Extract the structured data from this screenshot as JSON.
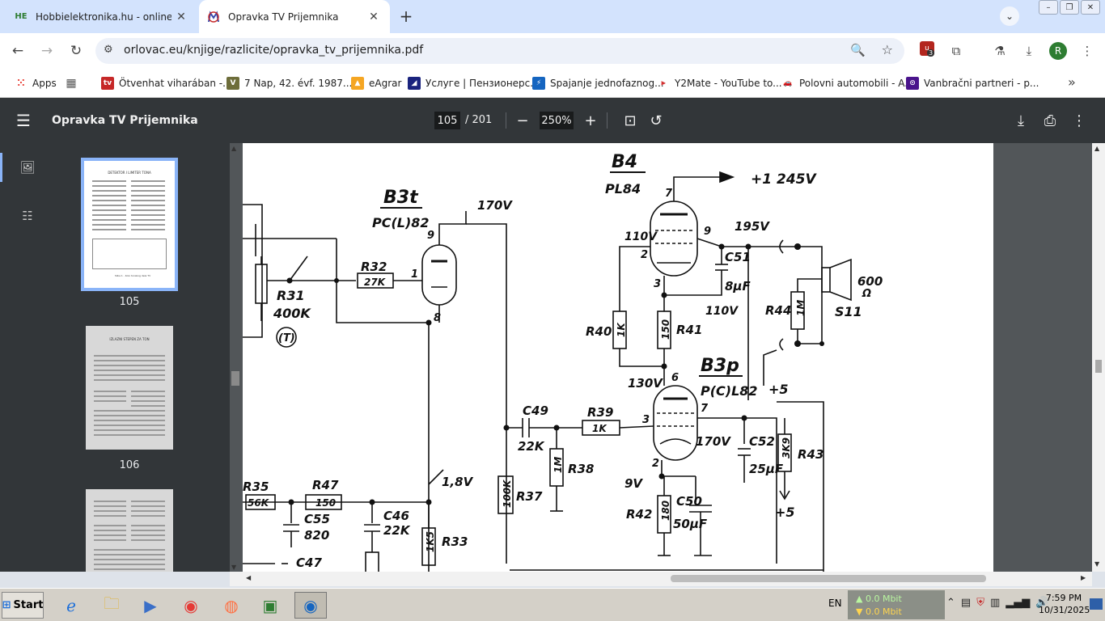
{
  "tabs": [
    {
      "title": "Hobbielektronika.hu - online elektronikai",
      "favicon": "HE"
    },
    {
      "title": "Opravka TV Prijemnika",
      "favicon": "PDF"
    }
  ],
  "address": {
    "url": "orlovac.eu/knjige/razlicite/opravka_tv_prijemnika.pdf",
    "profile_initial": "R",
    "ext_badge_count": "3"
  },
  "bookmarks": [
    {
      "label": "Apps",
      "icon_color": "#e8453c"
    },
    {
      "label": "",
      "icon_color": "#555555"
    },
    {
      "label": "Ötvenhat viharában -...",
      "icon_color": "#c62828"
    },
    {
      "label": "7 Nap, 42. évf. 1987....",
      "icon_color": "#6d6d3a"
    },
    {
      "label": "eAgrar",
      "icon_color": "#f5a623"
    },
    {
      "label": "Услуге | Пензионерс...",
      "icon_color": "#1a237e"
    },
    {
      "label": "Spajanje jednofaznog...",
      "icon_color": "#1565c0"
    },
    {
      "label": "Y2Mate - YouTube to...",
      "icon_color": "#d32f2f"
    },
    {
      "label": "Polovni automobili - A...",
      "icon_color": "#f9a825"
    },
    {
      "label": "Vanbračni partneri - p...",
      "icon_color": "#4a148c"
    }
  ],
  "pdf": {
    "title": "Opravka TV Prijemnika",
    "page_current": "105",
    "page_total": "/ 201",
    "zoom": "250%",
    "thumbs": [
      {
        "num": "105",
        "title": "DETEKTOR I LIMITER TONA",
        "footer": "Slika 1 - Kolo tonskog dela TV"
      },
      {
        "num": "106",
        "title": "IZLAZNI STEPEN ZA TON",
        "footer": ""
      },
      {
        "num": "",
        "title": "",
        "footer": ""
      }
    ]
  },
  "schematic": {
    "labels": {
      "b4": "B4",
      "pl84": "PL84",
      "v245": "+1 245V",
      "v195": "195V",
      "c51": "C51",
      "uf8": "8µF",
      "v110a": "110V",
      "v110b": "110V",
      "b3t": "B3t",
      "pcl82a": "PC(L)82",
      "v170a": "170V",
      "r32": "R32",
      "k27": "27K",
      "r31": "R31",
      "k400": "400K",
      "t1": "(T)",
      "r40": "R40",
      "k1a": "1K",
      "r41": "R41",
      "o150a": "150",
      "r44": "R44",
      "m1": "1M",
      "s11": "S11",
      "o600": "600",
      "ohm": "Ω",
      "plus5a": "+5",
      "b3p": "B3p",
      "pcl82b": "P(C)L82",
      "v130": "130V",
      "c49": "C49",
      "k22a": "22K",
      "r39": "R39",
      "k1b": "1K",
      "r38": "R38",
      "m1b": "1M",
      "v170b": "170V",
      "c52": "C52",
      "uf25": "25µF",
      "k3k9": "3K9",
      "r43": "R43",
      "plus5b": "+5",
      "r37": "R37",
      "k100": "100K",
      "v9": "9V",
      "c50": "C50",
      "uf50": "50µF",
      "r42": "R42",
      "o180": "180",
      "r35": "R35",
      "k56": "56K",
      "r47": "R47",
      "o150b": "150",
      "c55": "C55",
      "p820": "820",
      "c46": "C46",
      "k22b": "22K",
      "v18": "1,8V",
      "k1k5": "1K5",
      "r33": "R33",
      "c47": "C47",
      "pin7a": "7",
      "pin9a": "9",
      "pin2a": "2",
      "pin3a": "3",
      "pin9b": "9",
      "pin1": "1",
      "pin8": "8",
      "pin6": "6",
      "pin7b": "7",
      "pin3b": "3",
      "pin2b": "2"
    }
  },
  "taskbar": {
    "start": "Start",
    "lang": "EN",
    "net_up": "0.0 Mbit",
    "net_down": "0.0 Mbit",
    "time": "7:59 PM",
    "date": "10/31/2025"
  }
}
